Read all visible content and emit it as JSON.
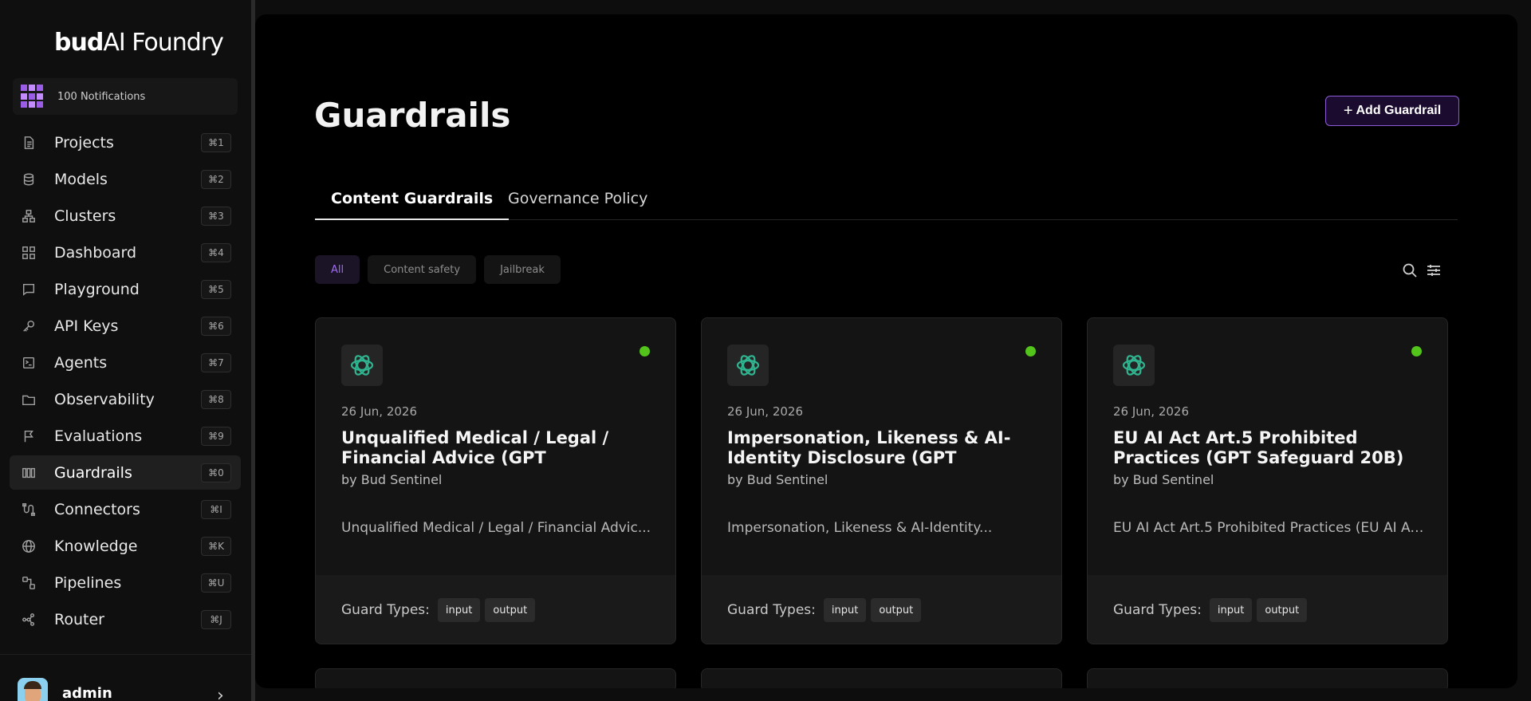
{
  "sidebar": {
    "logo": {
      "bold": "bud",
      "regular": "AI Foundry"
    },
    "notifications": {
      "label": "100 Notifications"
    },
    "items": [
      {
        "label": "Projects",
        "shortcut": "⌘1",
        "icon": "document-icon"
      },
      {
        "label": "Models",
        "shortcut": "⌘2",
        "icon": "database-icon"
      },
      {
        "label": "Clusters",
        "shortcut": "⌘3",
        "icon": "cluster-icon"
      },
      {
        "label": "Dashboard",
        "shortcut": "⌘4",
        "icon": "grid-icon"
      },
      {
        "label": "Playground",
        "shortcut": "⌘5",
        "icon": "chat-icon"
      },
      {
        "label": "API Keys",
        "shortcut": "⌘6",
        "icon": "key-icon"
      },
      {
        "label": "Agents",
        "shortcut": "⌘7",
        "icon": "terminal-icon"
      },
      {
        "label": "Observability",
        "shortcut": "⌘8",
        "icon": "folder-icon"
      },
      {
        "label": "Evaluations",
        "shortcut": "⌘9",
        "icon": "flag-icon"
      },
      {
        "label": "Guardrails",
        "shortcut": "⌘0",
        "icon": "guardrail-icon",
        "active": true
      },
      {
        "label": "Connectors",
        "shortcut": "⌘I",
        "icon": "connector-icon"
      },
      {
        "label": "Knowledge",
        "shortcut": "⌘K",
        "icon": "globe-icon"
      },
      {
        "label": "Pipelines",
        "shortcut": "⌘U",
        "icon": "pipeline-icon"
      },
      {
        "label": "Router",
        "shortcut": "⌘J",
        "icon": "router-icon"
      }
    ],
    "user": {
      "name": "admin"
    }
  },
  "main": {
    "title": "Guardrails",
    "add_button": "Add Guardrail",
    "tabs": [
      {
        "label": "Content Guardrails",
        "active": true
      },
      {
        "label": "Governance Policy",
        "active": false
      }
    ],
    "filters": [
      {
        "label": "All",
        "active": true
      },
      {
        "label": "Content safety",
        "active": false
      },
      {
        "label": "Jailbreak",
        "active": false
      }
    ],
    "cards": [
      {
        "date": "26 Jun, 2026",
        "title": "Unqualified Medical / Legal / Financial Advice (GPT Safeguard...",
        "author": "by Bud Sentinel",
        "description": "Unqualified Medical / Legal / Financial Advic...",
        "guard_types_label": "Guard Types:",
        "guard_types": [
          "input",
          "output"
        ],
        "status": "active"
      },
      {
        "date": "26 Jun, 2026",
        "title": "Impersonation, Likeness & AI-Identity Disclosure (GPT Safeguar...",
        "author": "by Bud Sentinel",
        "description": "Impersonation, Likeness & AI-Identity...",
        "guard_types_label": "Guard Types:",
        "guard_types": [
          "input",
          "output"
        ],
        "status": "active"
      },
      {
        "date": "26 Jun, 2026",
        "title": "EU AI Act Art.5 Prohibited Practices (GPT Safeguard 20B)",
        "author": "by Bud Sentinel",
        "description": "EU AI Act Art.5 Prohibited Practices (EU AI Ac...",
        "guard_types_label": "Guard Types:",
        "guard_types": [
          "input",
          "output"
        ],
        "status": "active"
      }
    ]
  },
  "colors": {
    "accent": "#9b5de5",
    "status_active": "#52c41a",
    "button_border": "#8b5cd6"
  }
}
